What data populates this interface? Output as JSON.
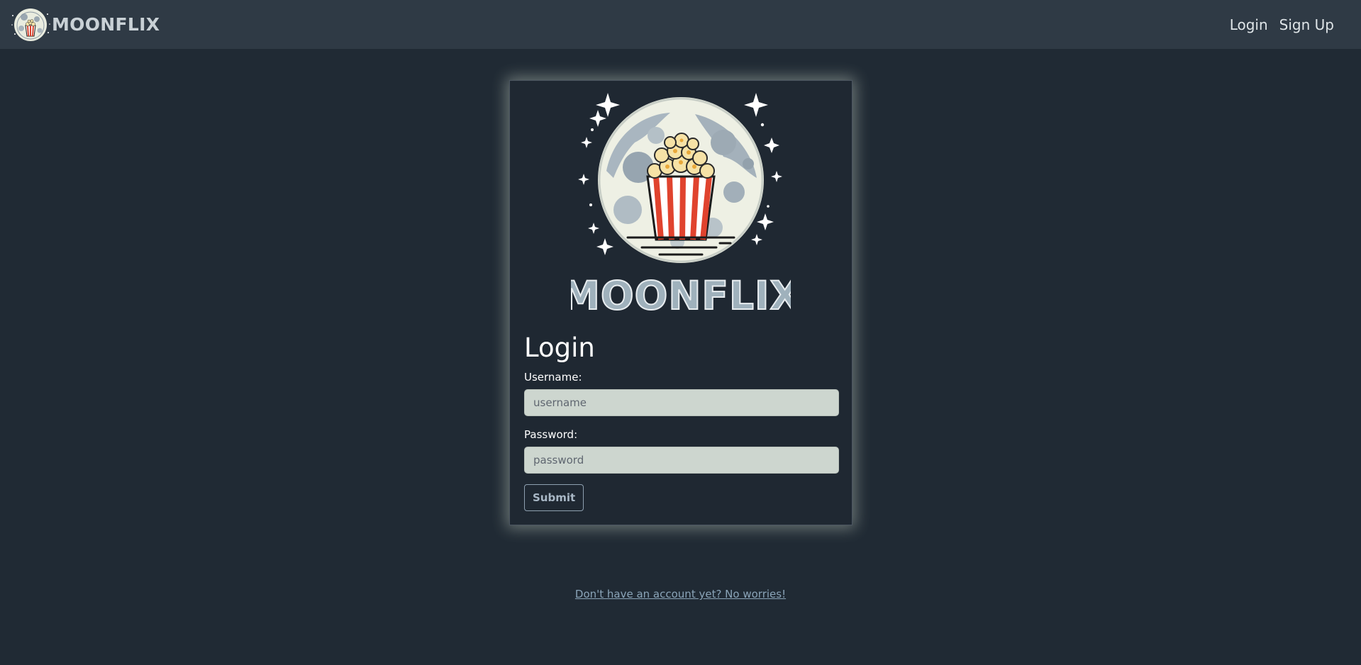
{
  "navbar": {
    "brand_text": "MOONFLIX",
    "links": [
      {
        "label": "Login"
      },
      {
        "label": "Sign Up"
      }
    ]
  },
  "card": {
    "logo_text": "MOONFLIX",
    "title": "Login",
    "username_label": "Username:",
    "username_placeholder": "username",
    "username_value": "",
    "password_label": "Password:",
    "password_placeholder": "password",
    "password_value": "",
    "submit_label": "Submit"
  },
  "footer": {
    "signup_link": "Don't have an account yet? No worries!"
  },
  "colors": {
    "background": "#202a34",
    "navbar": "#2f3a45",
    "input_bg": "#cdd6cf",
    "link": "#8aa4b8"
  }
}
